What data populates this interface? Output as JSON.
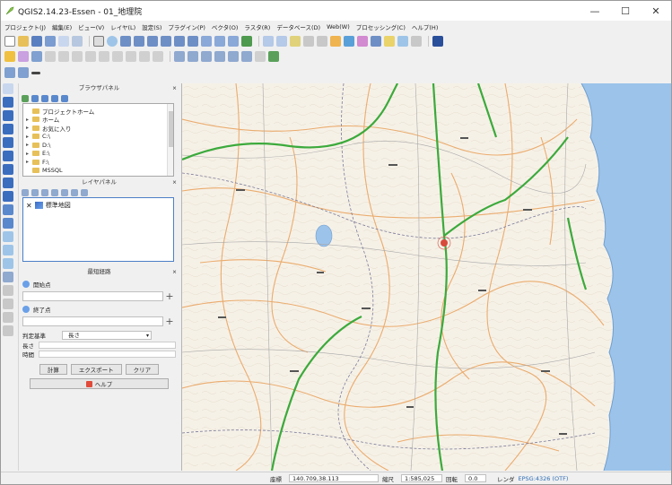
{
  "window": {
    "title": "QGIS2.14.23-Essen - 01_地理院",
    "minimize_glyph": "—",
    "maximize_glyph": "☐",
    "close_glyph": "✕"
  },
  "menu": [
    "プロジェクト(J)",
    "編集(E)",
    "ビュー(V)",
    "レイヤ(L)",
    "設定(S)",
    "プラグイン(P)",
    "ベクタ(O)",
    "ラスタ(R)",
    "データベース(D)",
    "Web(W)",
    "プロセッシング(C)",
    "ヘルプ(H)"
  ],
  "browser_panel": {
    "title": "ブラウザパネル",
    "close_glyph": "⨯",
    "items": [
      {
        "expander": "",
        "label": "プロジェクトホーム"
      },
      {
        "expander": "▸",
        "label": "ホーム"
      },
      {
        "expander": "▸",
        "label": "お気に入り"
      },
      {
        "expander": "▸",
        "label": "C:\\"
      },
      {
        "expander": "▸",
        "label": "D:\\"
      },
      {
        "expander": "▸",
        "label": "E:\\"
      },
      {
        "expander": "▸",
        "label": "F:\\"
      },
      {
        "expander": "",
        "label": "MSSQL"
      }
    ]
  },
  "layers_panel": {
    "title": "レイヤパネル",
    "close_glyph": "⨯",
    "layers": [
      {
        "checked": "✕",
        "name": "標準地図"
      }
    ]
  },
  "route_panel": {
    "title": "最短経路",
    "close_glyph": "⨯",
    "start_label": "開始点",
    "end_label": "終了点",
    "plus_glyph": "+",
    "criterion_label": "判定基準",
    "criterion_value": "長さ",
    "length_label": "長さ",
    "time_label": "時間",
    "calc_button": "計算",
    "export_button": "エクスポート",
    "clear_button": "クリア",
    "help_button": "ヘルプ"
  },
  "status": {
    "coord_label": "座標",
    "coord_value": "140.709,38.113",
    "scale_label": "縮尺",
    "scale_value": "1:585,025",
    "rotation_label": "回転",
    "rotation_value": "0.0",
    "render_label": "レンダ",
    "crs_value": "EPSG:4326 (OTF)"
  },
  "colors": {
    "map_land": "#f6f1e7",
    "map_sea": "#9cc3ea",
    "road_green": "#3caa3c",
    "road_orange": "#e9a05a",
    "accent_blue": "#4b7fc7"
  },
  "icons": {
    "app": "qgis-icon",
    "layer": "raster-layer-icon",
    "folder": "folder-icon"
  }
}
